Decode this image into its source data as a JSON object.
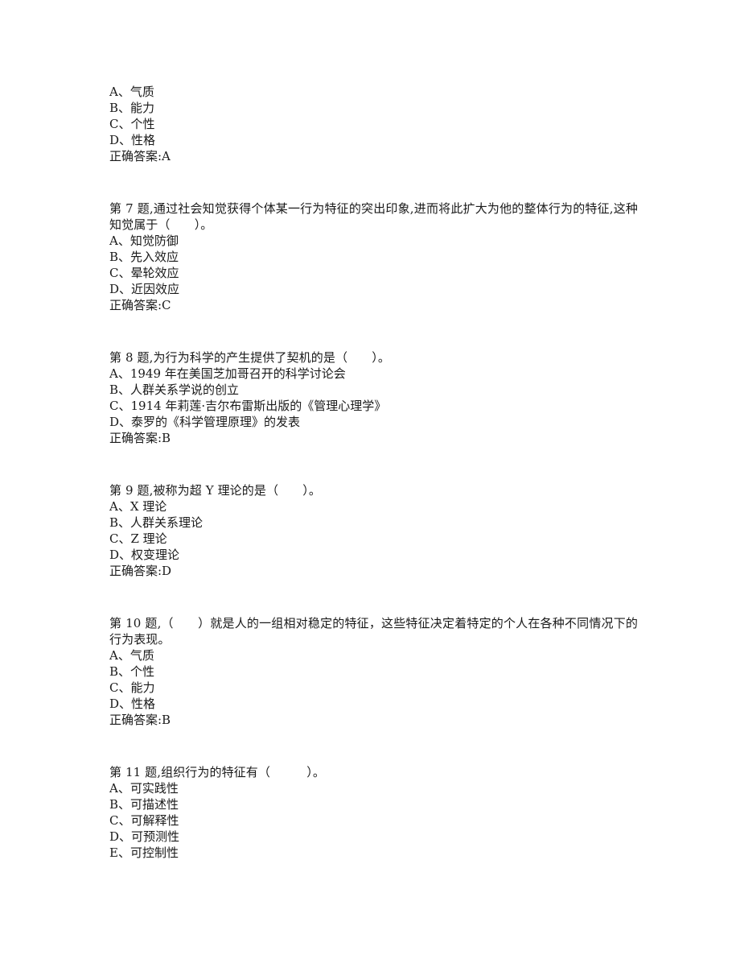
{
  "page": {
    "background_color": "#ffffff",
    "text_color": "#1a1a1a"
  },
  "questions": [
    {
      "id": "q6-continuation",
      "stem": "",
      "options": [
        "A、气质",
        "B、能力",
        "C、个性",
        "D、性格"
      ],
      "answer": "正确答案:A"
    },
    {
      "id": "q7",
      "stem": "第 7 题,通过社会知觉获得个体某一行为特征的突出印象,进而将此扩大为他的整体行为的特征,这种知觉属于（　　）。",
      "options": [
        "A、知觉防御",
        "B、先入效应",
        "C、晕轮效应",
        "D、近因效应"
      ],
      "answer": "正确答案:C"
    },
    {
      "id": "q8",
      "stem": "第 8 题,为行为科学的产生提供了契机的是（　　）。",
      "options": [
        "A、1949 年在美国芝加哥召开的科学讨论会",
        "B、人群关系学说的创立",
        "C、1914 年莉莲·吉尔布雷斯出版的《管理心理学》",
        "D、泰罗的《科学管理原理》的发表"
      ],
      "answer": "正确答案:B"
    },
    {
      "id": "q9",
      "stem": "第 9 题,被称为超 Y 理论的是（　　）。",
      "options": [
        "A、X 理论",
        "B、人群关系理论",
        "C、Z 理论",
        "D、权变理论"
      ],
      "answer": "正确答案:D"
    },
    {
      "id": "q10",
      "stem": "第 10 题,（　　）就是人的一组相对稳定的特征，这些特征决定着特定的个人在各种不同情况下的行为表现。",
      "options": [
        "A、气质",
        "B、个性",
        "C、能力",
        "D、性格"
      ],
      "answer": "正确答案:B"
    },
    {
      "id": "q11",
      "stem": "第 11 题,组织行为的特征有（　　　）。",
      "options": [
        "A、可实践性",
        "B、可描述性",
        "C、可解释性",
        "D、可预测性",
        "E、可控制性"
      ],
      "answer": ""
    }
  ]
}
